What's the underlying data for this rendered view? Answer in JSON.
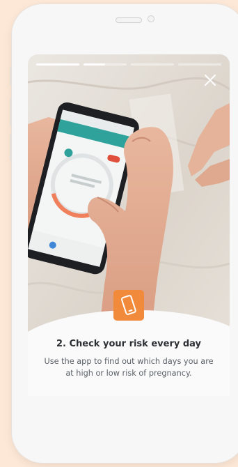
{
  "story": {
    "progress": [
      1,
      0.5,
      0,
      0
    ],
    "title": "2. Check your risk every day",
    "description": "Use the app to find out which days you are at high or low risk of pregnancy."
  },
  "colors": {
    "background": "#fde7d6",
    "accent": "#f28a3c",
    "app_header": "#2fa39b"
  },
  "icons": {
    "close": "close-icon",
    "badge": "smartphone-icon"
  }
}
